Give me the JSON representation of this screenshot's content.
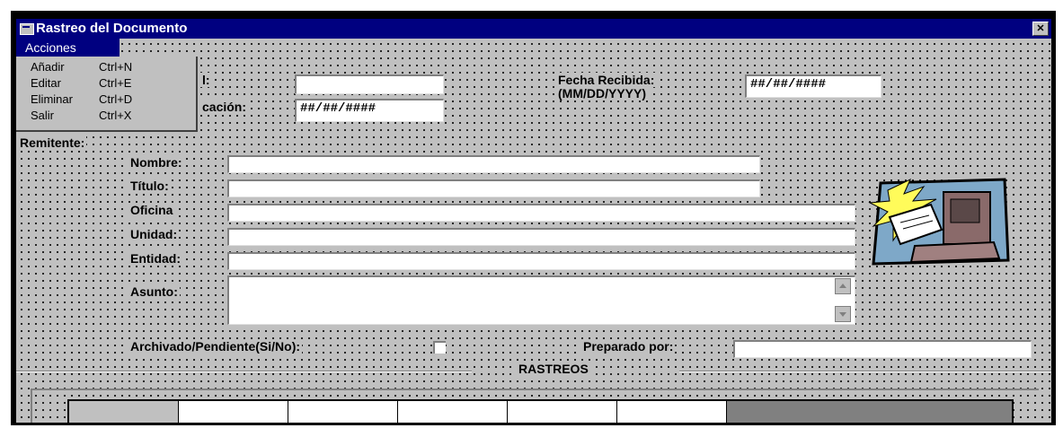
{
  "window": {
    "title": "Rastreo del Documento",
    "close_label": "✕"
  },
  "menu": {
    "label": "Acciones",
    "items": [
      {
        "label": "Añadir",
        "shortcut": "Ctrl+N"
      },
      {
        "label": "Editar",
        "shortcut": "Ctrl+E"
      },
      {
        "label": "Eliminar",
        "shortcut": "Ctrl+D"
      },
      {
        "label": "Salir",
        "shortcut": "Ctrl+X"
      }
    ]
  },
  "header": {
    "partial_label_1": "l:",
    "field_1_value": "",
    "partial_label_2": "cación:",
    "field_2_value": "##/##/####",
    "fecha_recibida_label_1": "Fecha Recibida:",
    "fecha_recibida_label_2": "(MM/DD/YYYY)",
    "fecha_recibida_value": "##/##/####"
  },
  "remitente": {
    "section_label": "Remitente:",
    "nombre_label": "Nombre:",
    "nombre_value": "",
    "titulo_label": "Título:",
    "titulo_value": "",
    "oficina_label": "Oficina",
    "oficina_value": "",
    "unidad_label": "Unidad:",
    "unidad_value": "",
    "entidad_label": "Entidad:",
    "entidad_value": ""
  },
  "asunto": {
    "label": "Asunto:",
    "value": ""
  },
  "archivado": {
    "label": "Archivado/Pendiente(Si/No):",
    "checked": false
  },
  "preparado": {
    "label": "Preparado por:",
    "value": ""
  },
  "rastreos": {
    "label": "RASTREOS"
  },
  "colors": {
    "titlebar": "#000080",
    "face": "#c0c0c0",
    "grid_bg": "#808080"
  }
}
